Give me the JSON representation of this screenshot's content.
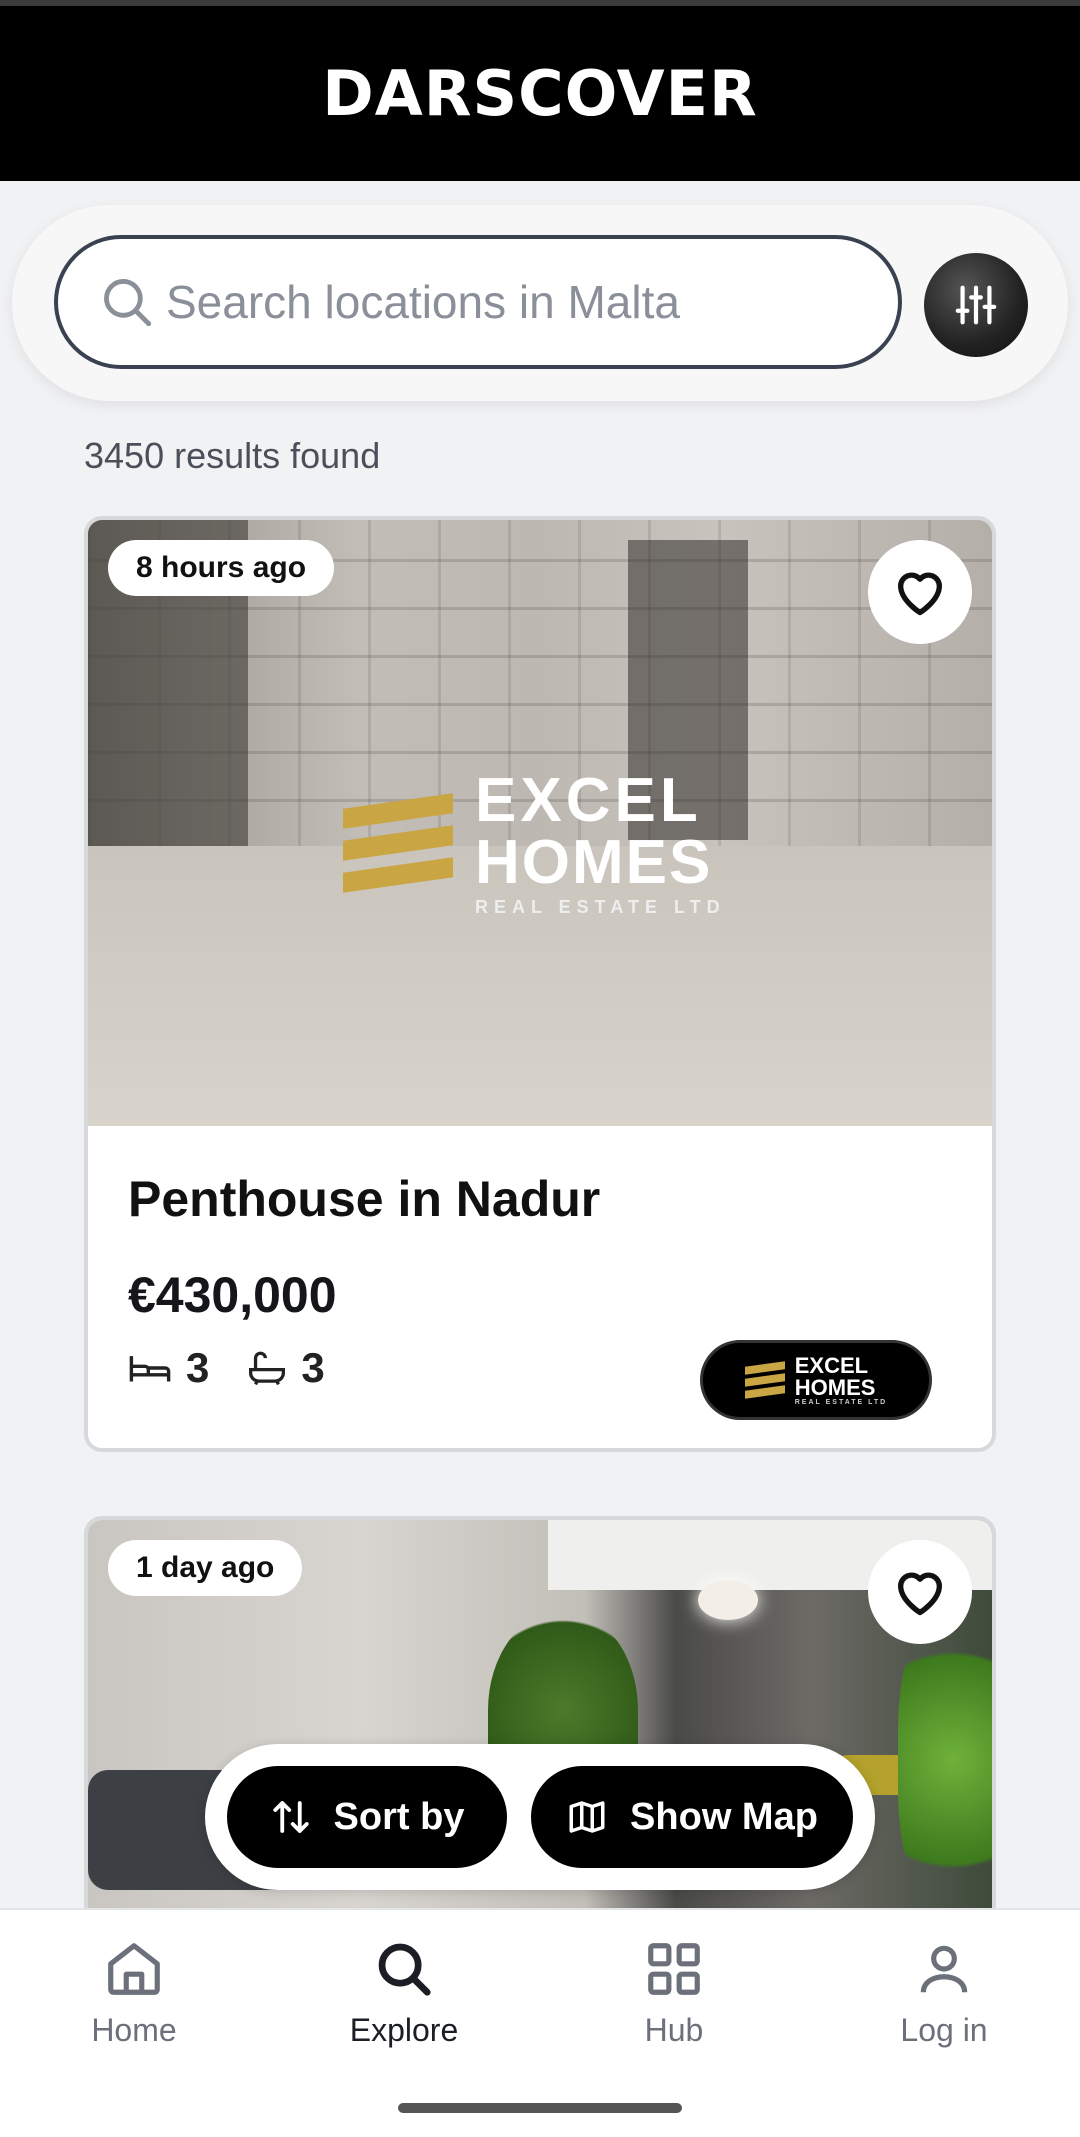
{
  "header": {
    "logo_text": "DARSCOVER"
  },
  "search": {
    "placeholder": "Search locations in Malta",
    "value": ""
  },
  "results": {
    "summary": "3450 results found"
  },
  "listings": [
    {
      "time_ago": "8 hours ago",
      "title": "Penthouse in Nadur",
      "price": "€430,000",
      "bedrooms": "3",
      "bathrooms": "3",
      "agency": {
        "line1": "EXCEL",
        "line2": "HOMES",
        "line3": "REAL ESTATE LTD"
      }
    },
    {
      "time_ago": "1 day ago"
    }
  ],
  "actions": {
    "sort_label": "Sort by",
    "map_label": "Show Map"
  },
  "nav": {
    "items": [
      {
        "label": "Home",
        "icon": "home-icon"
      },
      {
        "label": "Explore",
        "icon": "search-icon",
        "active": true
      },
      {
        "label": "Hub",
        "icon": "grid-icon"
      },
      {
        "label": "Log in",
        "icon": "user-icon"
      }
    ]
  },
  "colors": {
    "header_bg": "#000000",
    "accent_gold": "#c9a544",
    "page_bg": "#f1f2f4"
  }
}
